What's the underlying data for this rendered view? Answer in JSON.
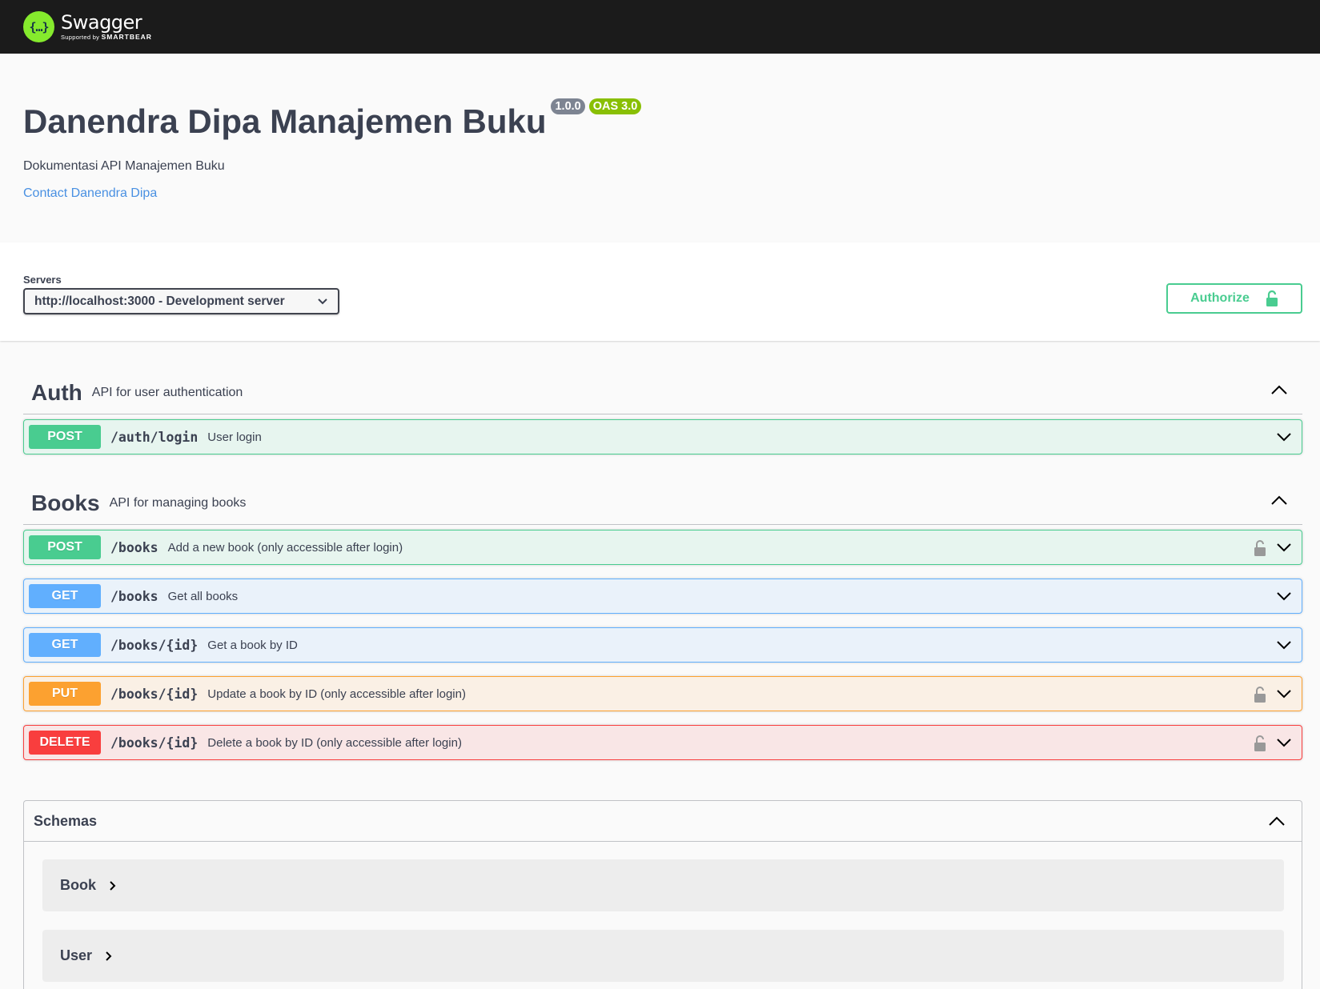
{
  "topbar": {
    "logo_name": "Swagger",
    "logo_supported_by": "Supported by",
    "logo_company": "SMARTBEAR"
  },
  "info": {
    "title": "Danendra Dipa Manajemen Buku",
    "version": "1.0.0",
    "oas": "OAS 3.0",
    "description": "Dokumentasi API Manajemen Buku",
    "contact": "Contact Danendra Dipa"
  },
  "servers": {
    "label": "Servers",
    "selected": "http://localhost:3000 - Development server"
  },
  "authorize": {
    "label": "Authorize"
  },
  "tags": [
    {
      "name": "Auth",
      "description": "API for user authentication",
      "operations": [
        {
          "method": "POST",
          "path": "/auth/login",
          "summary": "User login",
          "locked": false
        }
      ]
    },
    {
      "name": "Books",
      "description": "API for managing books",
      "operations": [
        {
          "method": "POST",
          "path": "/books",
          "summary": "Add a new book (only accessible after login)",
          "locked": true
        },
        {
          "method": "GET",
          "path": "/books",
          "summary": "Get all books",
          "locked": false
        },
        {
          "method": "GET",
          "path": "/books/{id}",
          "summary": "Get a book by ID",
          "locked": false
        },
        {
          "method": "PUT",
          "path": "/books/{id}",
          "summary": "Update a book by ID (only accessible after login)",
          "locked": true
        },
        {
          "method": "DELETE",
          "path": "/books/{id}",
          "summary": "Delete a book by ID (only accessible after login)",
          "locked": true
        }
      ]
    }
  ],
  "schemas": {
    "title": "Schemas",
    "items": [
      "Book",
      "User"
    ]
  },
  "colors": {
    "post": "#49cc90",
    "get": "#61affe",
    "put": "#fca130",
    "delete": "#f93e3e",
    "link": "#4990e2"
  }
}
